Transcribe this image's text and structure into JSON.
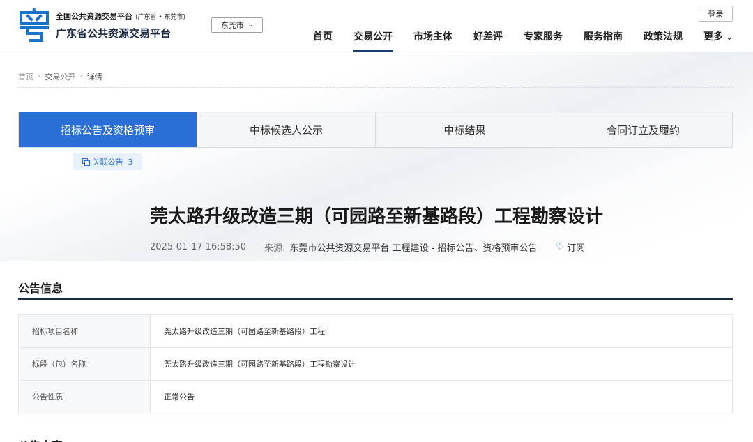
{
  "header": {
    "site_sub": "全国公共资源交易平台",
    "region": "(广东省 • 东莞市)",
    "site_title": "广东省公共资源交易平台",
    "city": "东莞市",
    "login": "登录",
    "nav": [
      "首页",
      "交易公开",
      "市场主体",
      "好差评",
      "专家服务",
      "服务指南",
      "政策法规",
      "更多"
    ],
    "nav_active": "交易公开",
    "logo_color": "#1a73c9",
    "accent": "#2b6fd6"
  },
  "breadcrumb": {
    "home": "首页",
    "sep": "›",
    "level1": "交易公开",
    "current": "详情"
  },
  "tabs": [
    "招标公告及资格预审",
    "中标候选人公示",
    "中标结果",
    "合同订立及履约"
  ],
  "related": {
    "label": "关联公告",
    "count": "3"
  },
  "article": {
    "title": "莞太路升级改造三期（可园路至新基路段）工程勘察设计",
    "datetime": "2025-01-17 16:58:50",
    "source_label": "来源:",
    "source": "东莞市公共资源交易平台 工程建设 - 招标公告、资格预审公告",
    "subscribe": "订阅"
  },
  "info": {
    "section_title": "公告信息",
    "rows": [
      {
        "key": "招标项目名称",
        "value": "莞太路升级改造三期（可园路至新基路段）工程"
      },
      {
        "key": "标段（包）名称",
        "value": "莞太路升级改造三期（可园路至新基路段）工程勘察设计"
      },
      {
        "key": "公告性质",
        "value": "正常公告"
      }
    ]
  },
  "next_section_title": "公告内容"
}
